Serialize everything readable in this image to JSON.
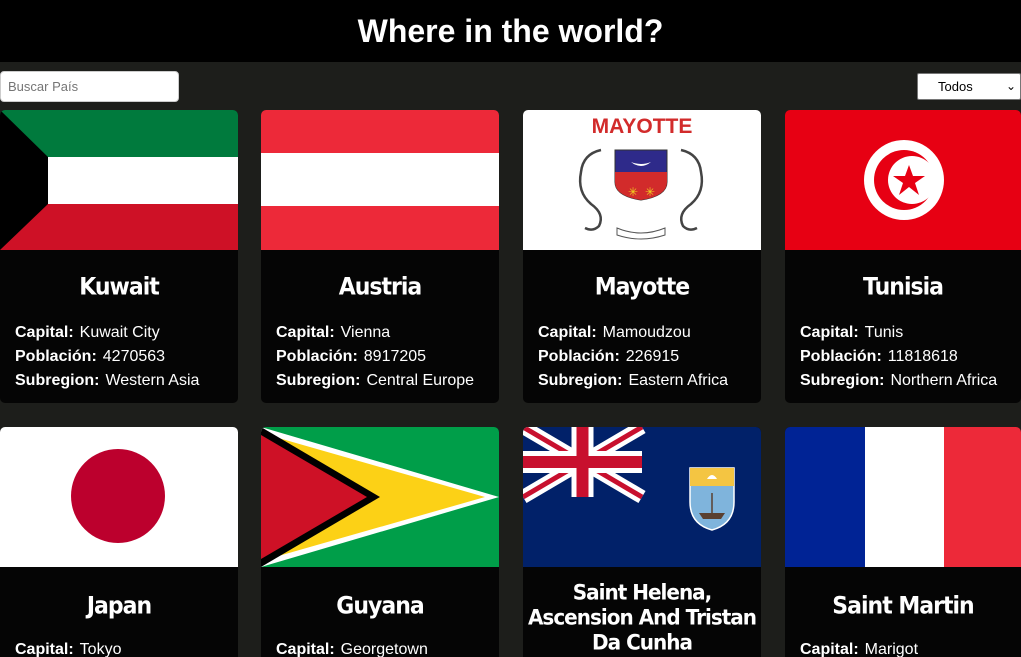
{
  "header": {
    "title": "Where in the world?"
  },
  "search": {
    "placeholder": "Buscar País"
  },
  "filter": {
    "selected": "Todos"
  },
  "labels": {
    "capital": "Capital:",
    "population": "Población:",
    "subregion": "Subregion:"
  },
  "countries": [
    {
      "name": "Kuwait",
      "capital": "Kuwait City",
      "population": "4270563",
      "subregion": "Western Asia",
      "flag": "kuwait-flag"
    },
    {
      "name": "Austria",
      "capital": "Vienna",
      "population": "8917205",
      "subregion": "Central Europe",
      "flag": "austria-flag"
    },
    {
      "name": "Mayotte",
      "capital": "Mamoudzou",
      "population": "226915",
      "subregion": "Eastern Africa",
      "flag": "mayotte-flag",
      "flag_text": "MAYOTTE"
    },
    {
      "name": "Tunisia",
      "capital": "Tunis",
      "population": "11818618",
      "subregion": "Northern Africa",
      "flag": "tunisia-flag"
    },
    {
      "name": "Japan",
      "capital": "Tokyo",
      "flag": "japan-flag"
    },
    {
      "name": "Guyana",
      "capital": "Georgetown",
      "flag": "guyana-flag"
    },
    {
      "name": "Saint Helena, Ascension And Tristan Da Cunha",
      "flag": "saint-helena-flag"
    },
    {
      "name": "Saint Martin",
      "capital": "Marigot",
      "flag": "france-flag"
    }
  ],
  "colors": {
    "header_bg": "#000000",
    "page_bg": "#1d1e1b",
    "card_bg": "#050505"
  }
}
